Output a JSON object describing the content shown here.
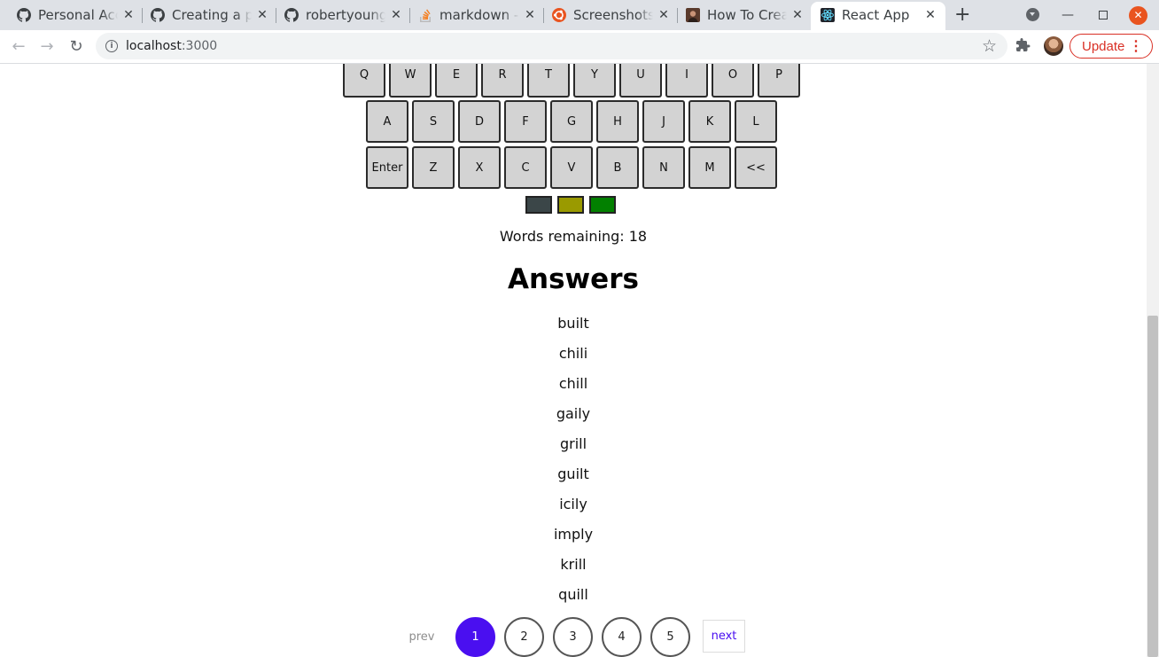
{
  "browser": {
    "tabs": [
      {
        "title": "Personal Acc",
        "icon": "github-icon"
      },
      {
        "title": "Creating a pe",
        "icon": "github-icon"
      },
      {
        "title": "robertyoung",
        "icon": "github-icon"
      },
      {
        "title": "markdown - I",
        "icon": "stackoverflow-icon"
      },
      {
        "title": "Screenshots",
        "icon": "ubuntu-icon"
      },
      {
        "title": "How To Crea",
        "icon": "avatar-thumbnail-icon"
      },
      {
        "title": "React App",
        "icon": "react-icon",
        "active": true
      }
    ],
    "url_host": "localhost",
    "url_port": ":3000",
    "update_label": "Update",
    "accent_color": "#d93025"
  },
  "keyboard": {
    "rows": [
      [
        "Q",
        "W",
        "E",
        "R",
        "T",
        "Y",
        "U",
        "I",
        "O",
        "P"
      ],
      [
        "A",
        "S",
        "D",
        "F",
        "G",
        "H",
        "J",
        "K",
        "L"
      ],
      [
        "Enter",
        "Z",
        "X",
        "C",
        "V",
        "B",
        "N",
        "M",
        "<<"
      ]
    ],
    "key_color": "#d3d3d3"
  },
  "color_swatches": [
    "#3b4648",
    "#9a9a00",
    "#028000"
  ],
  "words_remaining": "Words remaining: 18",
  "answers": {
    "title": "Answers",
    "items": [
      "built",
      "chili",
      "chill",
      "gaily",
      "grill",
      "guilt",
      "icily",
      "imply",
      "krill",
      "quill"
    ]
  },
  "pagination": {
    "prev_label": "prev",
    "next_label": "next",
    "pages": [
      "1",
      "2",
      "3",
      "4",
      "5"
    ],
    "active_page": "1",
    "active_color": "#4a0ff0"
  }
}
